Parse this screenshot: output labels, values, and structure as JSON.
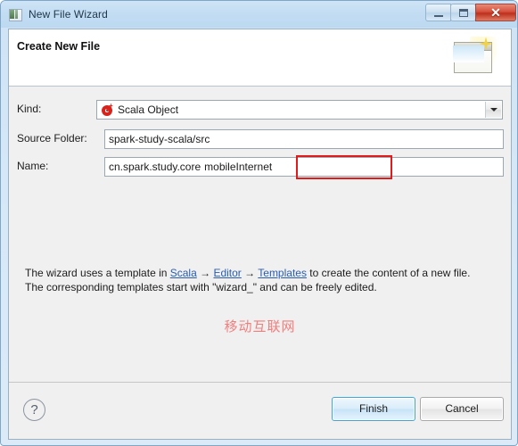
{
  "window": {
    "title": "New File Wizard",
    "icon": "file-wizard-icon",
    "controls": {
      "minimize": "minimize-button",
      "maximize": "maximize-button",
      "close_glyph": "✕"
    }
  },
  "header": {
    "title": "Create New File",
    "icon": "wizard-banner-icon"
  },
  "form": {
    "kind": {
      "label": "Kind:",
      "value": "Scala Object",
      "icon": "scala-object-icon"
    },
    "source_folder": {
      "label": "Source Folder:",
      "value": "spark-study-scala/src"
    },
    "name": {
      "label": "Name:",
      "package_value": "cn.spark.study.core",
      "highlighted_value": "mobileInternet",
      "full_value": "cn.spark.study.core.mobileInternet"
    }
  },
  "description": {
    "line1_before": "The wizard uses a template in ",
    "link_scala": "Scala",
    "arrow1": " → ",
    "link_editor": "Editor",
    "arrow2": " → ",
    "link_templates": "Templates",
    "line1_after": " to create the content of a new file.",
    "line2": "The corresponding templates start with \"wizard_\" and can be freely edited."
  },
  "annotation": {
    "chinese_note": "移动互联网",
    "color": "#f27d7d",
    "highlight_box_color": "#e01b1b"
  },
  "footer": {
    "help_label": "?",
    "finish_label": "Finish",
    "cancel_label": "Cancel"
  }
}
